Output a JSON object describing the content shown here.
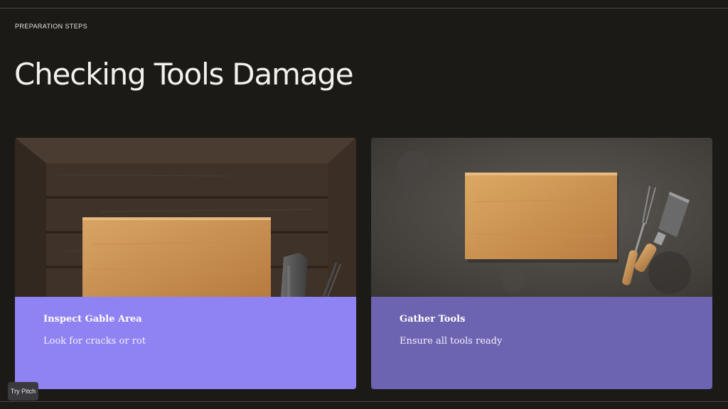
{
  "header": {
    "eyebrow": "PREPARATION STEPS",
    "title": "Checking Tools Damage"
  },
  "cards": [
    {
      "heading": "Inspect Gable Area",
      "text": "Look for cracks or rot",
      "panel_color": "#8f82f2",
      "image": "dark-wood-table-with-cutting-board-and-cleaver"
    },
    {
      "heading": "Gather Tools",
      "text": "Ensure all tools ready",
      "panel_color": "#6c63b1",
      "image": "stone-surface-with-cutting-board-fork-and-spatula"
    }
  ],
  "badge": {
    "label": "Try Pitch"
  },
  "colors": {
    "background": "#1c1a16",
    "text": "#f4f1ec"
  }
}
